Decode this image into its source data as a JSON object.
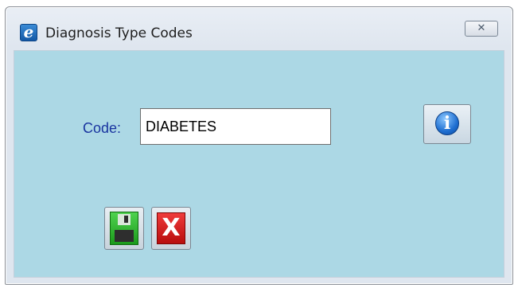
{
  "window": {
    "title": "Diagnosis Type Codes",
    "app_icon_letter": "e",
    "close_glyph": "✕"
  },
  "form": {
    "code_label": "Code:",
    "code_value": "DIABETES"
  },
  "buttons": {
    "info": {
      "icon": "info-icon",
      "glyph": "i"
    },
    "save": {
      "icon": "floppy-disk-icon"
    },
    "cancel": {
      "icon": "red-x-icon",
      "glyph": "X"
    }
  },
  "colors": {
    "client_background": "#acd8e5",
    "label_color": "#1a35a0",
    "save_green": "#2eb82e",
    "cancel_red": "#d11a1a",
    "info_blue": "#1f6fd1"
  }
}
